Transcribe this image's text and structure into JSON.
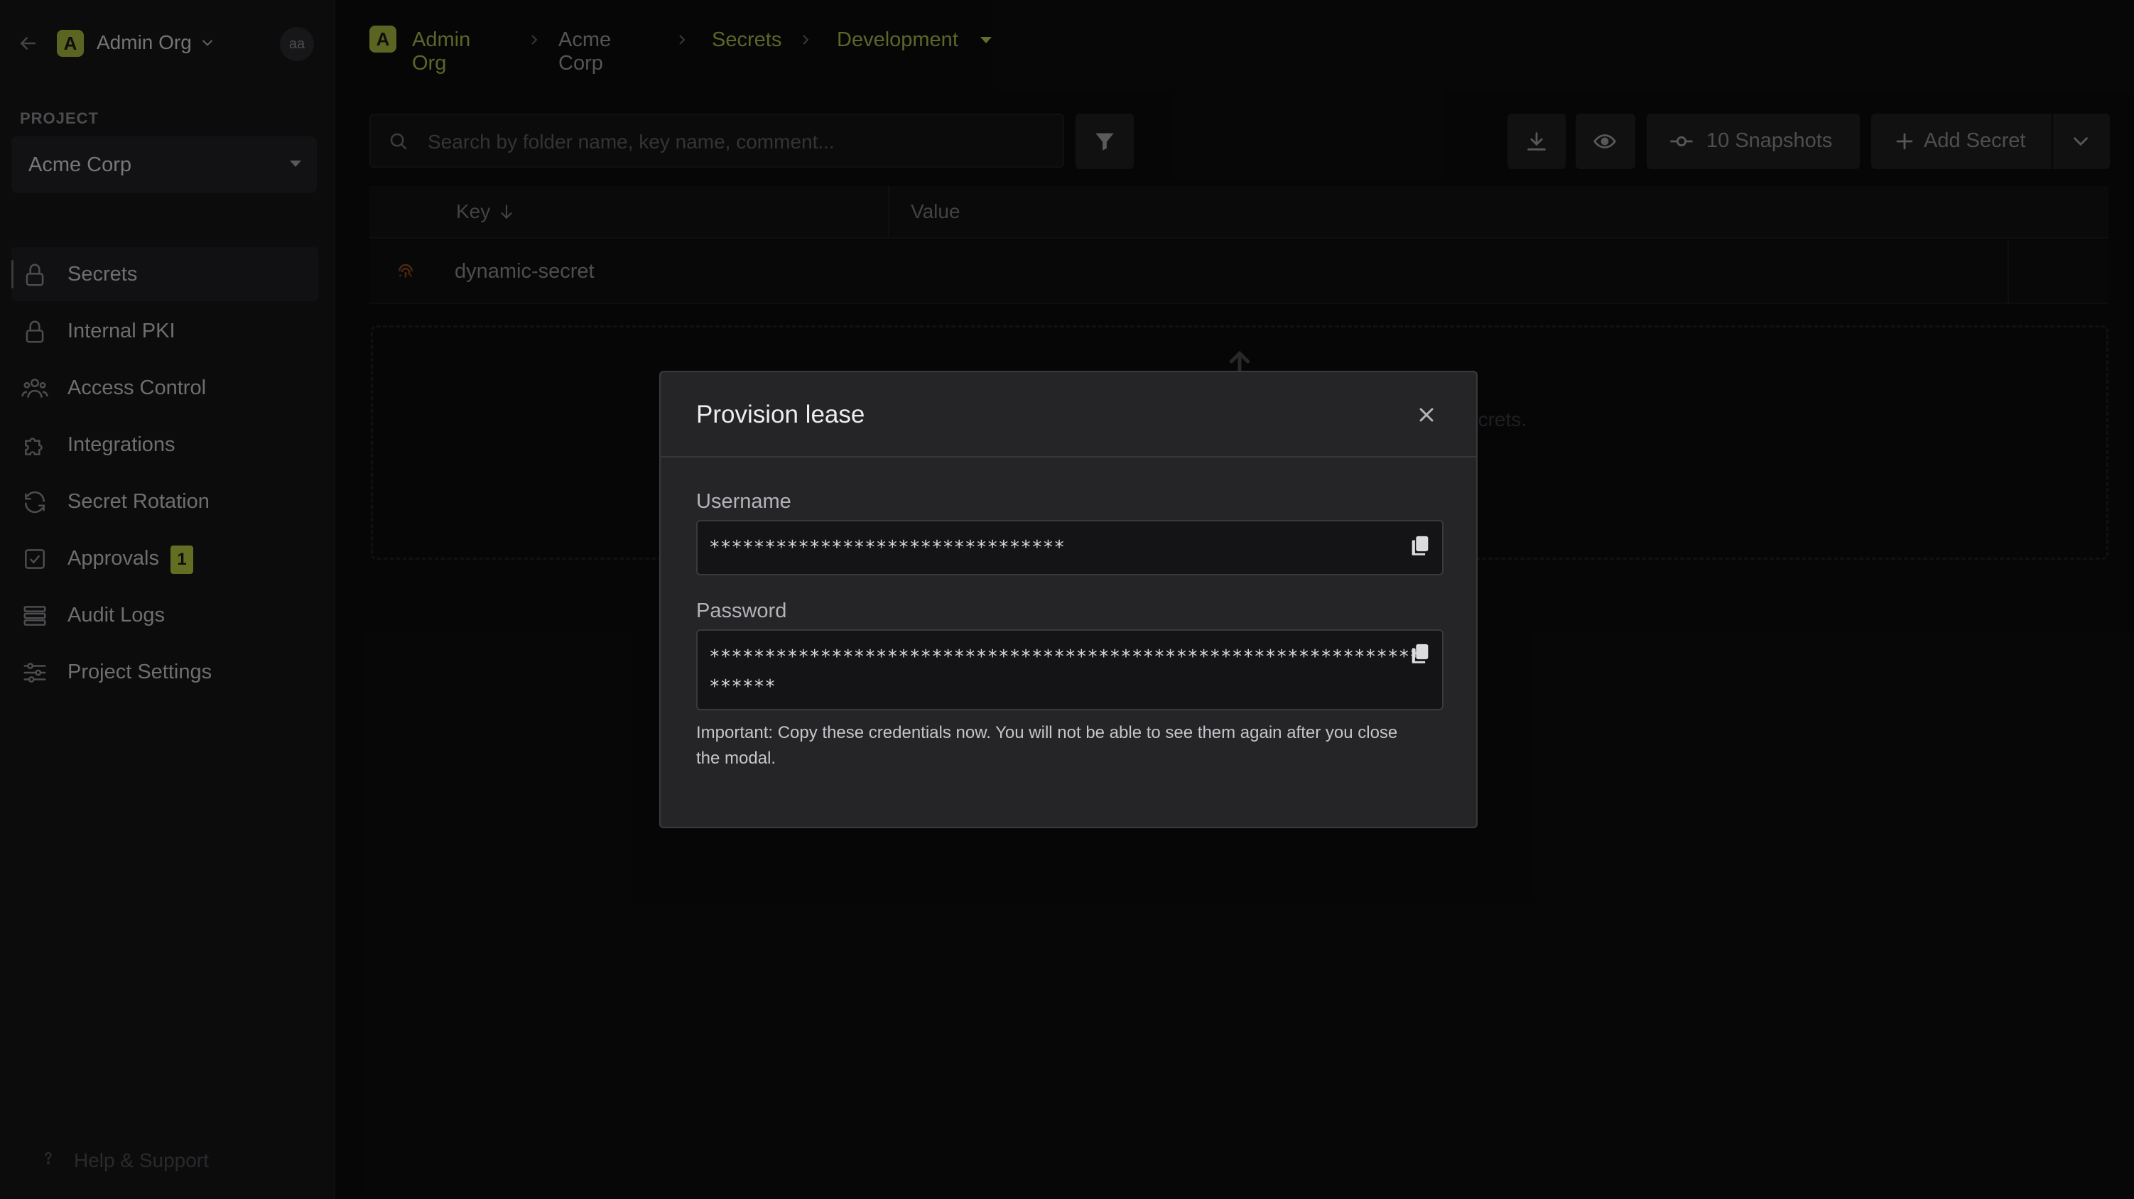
{
  "sidebar": {
    "org_badge": "A",
    "org_name": "Admin Org",
    "avatar_initials": "aa",
    "project_label": "PROJECT",
    "project_selected": "Acme Corp",
    "items": [
      {
        "label": "Secrets",
        "icon": "lock-icon",
        "active": true
      },
      {
        "label": "Internal PKI",
        "icon": "lock-icon"
      },
      {
        "label": "Access Control",
        "icon": "users-icon"
      },
      {
        "label": "Integrations",
        "icon": "puzzle-icon"
      },
      {
        "label": "Secret Rotation",
        "icon": "rotate-icon"
      },
      {
        "label": "Approvals",
        "icon": "checklist-icon",
        "badge": "1"
      },
      {
        "label": "Audit Logs",
        "icon": "list-icon"
      },
      {
        "label": "Project Settings",
        "icon": "sliders-icon"
      }
    ],
    "help_label": "Help & Support"
  },
  "breadcrumb": {
    "badge": "A",
    "org": "Admin Org",
    "project": "Acme Corp",
    "section": "Secrets",
    "environment": "Development"
  },
  "toolbar": {
    "search_placeholder": "Search by folder name, key name, comment...",
    "snapshots_label": "10 Snapshots",
    "add_secret_label": "Add Secret"
  },
  "table": {
    "columns": [
      "Key",
      "Value"
    ],
    "rows": [
      {
        "key": "dynamic-secret"
      }
    ],
    "dropzone_text": "ecrets."
  },
  "modal": {
    "title": "Provision lease",
    "username_label": "Username",
    "username_value": "********************************",
    "password_label": "Password",
    "password_value": "**********************************************************************",
    "note": "Important: Copy these credentials now. You will not be able to see them again after you close the modal."
  },
  "colors": {
    "accent": "#a6b83c",
    "background": "#0c0c0d",
    "sidebar": "#161618",
    "modal": "#252528"
  }
}
